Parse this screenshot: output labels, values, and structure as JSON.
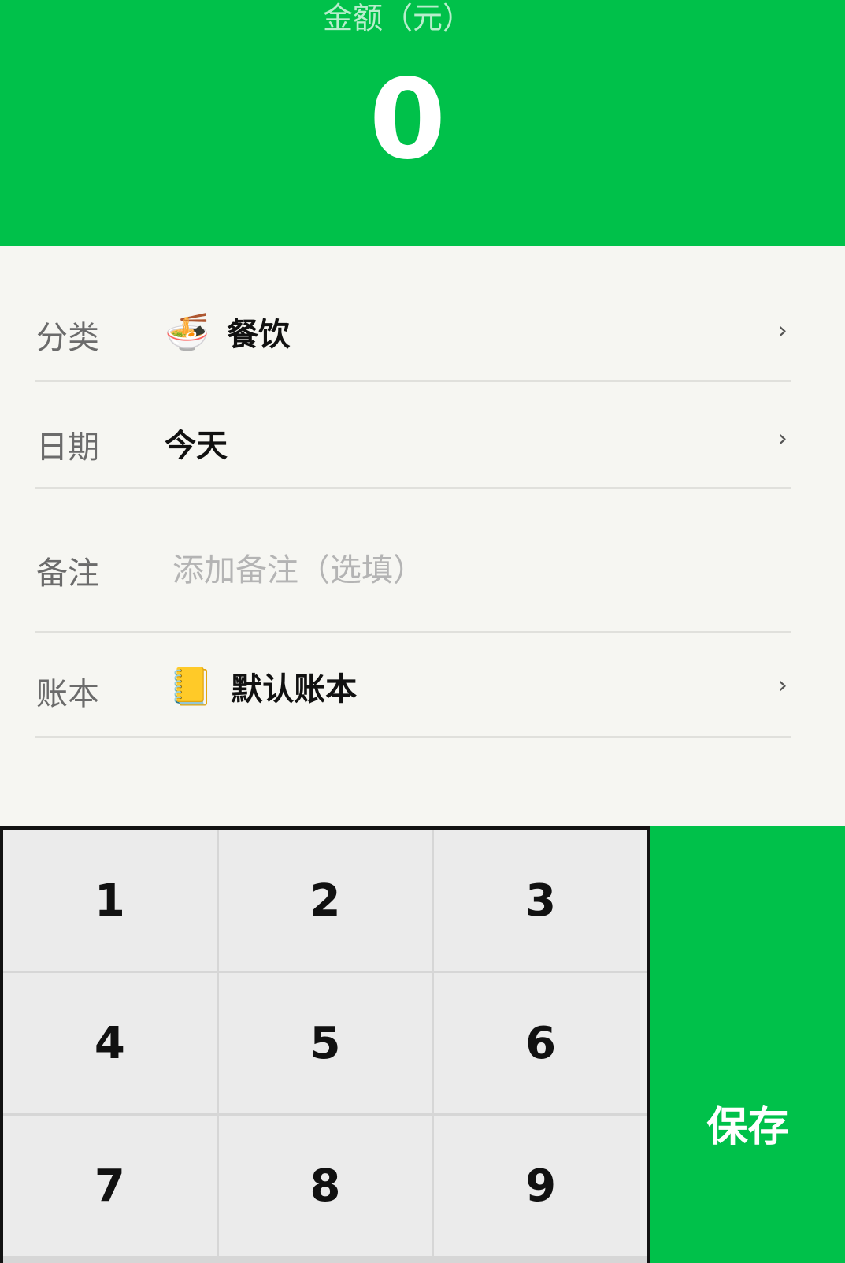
{
  "header": {
    "amount_label": "金额（元）",
    "amount_value": "0"
  },
  "form": {
    "category": {
      "label": "分类",
      "icon": "ramen-bowl-icon",
      "value": "餐饮"
    },
    "date": {
      "label": "日期",
      "value": "今天"
    },
    "note": {
      "label": "备注",
      "placeholder": "添加备注（选填）"
    },
    "ledger": {
      "label": "账本",
      "icon": "notebook-icon",
      "value": "默认账本"
    }
  },
  "keypad": {
    "keys": [
      "1",
      "2",
      "3",
      "4",
      "5",
      "6",
      "7",
      "8",
      "9"
    ],
    "save_label": "保存"
  },
  "colors": {
    "accent": "#00c14a",
    "background": "#f6f6f2",
    "key_background": "#ebebeb"
  }
}
